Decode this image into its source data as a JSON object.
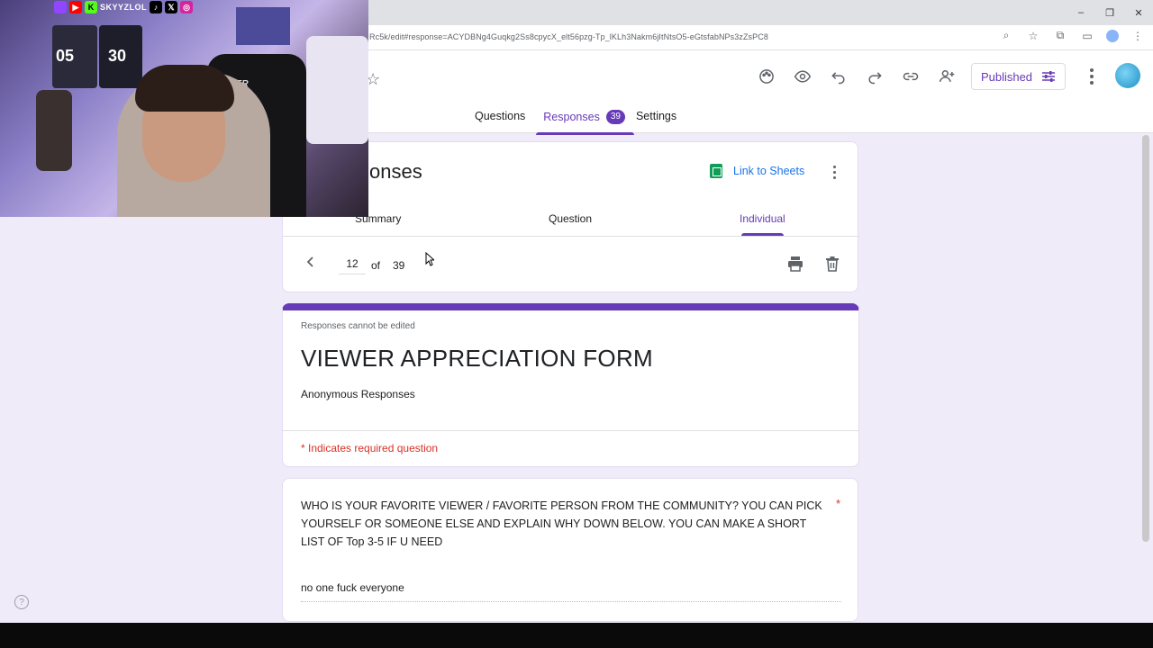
{
  "browser": {
    "url": "Rc5k/edit#response=ACYDBNg4Guqkg2Ss8cpycX_elt56pzg-Tp_lKLh3Nakm6jItNtsO5-eGtsfabNPs3zZsPC8",
    "window_controls": [
      "–",
      "❐",
      "✕"
    ]
  },
  "webcam": {
    "handle": "SKYYZLOL",
    "jersey1": "05",
    "jersey2": "30",
    "chair_brand": "RACER"
  },
  "forms_header": {
    "published_label": "Published",
    "tabs": {
      "questions": "Questions",
      "responses": "Responses",
      "responses_count": "39",
      "settings": "Settings"
    }
  },
  "responses_card": {
    "title_fragment": "onses",
    "link_to_sheets": "Link to Sheets",
    "subtabs": {
      "summary": "Summary",
      "question": "Question",
      "individual": "Individual"
    },
    "current_page": "12",
    "of_label": "of",
    "total": "39"
  },
  "form": {
    "not_editable": "Responses cannot be edited",
    "title": "VIEWER APPRECIATION FORM",
    "description": "Anonymous Responses",
    "required_note": "* Indicates required question"
  },
  "question": {
    "text": "WHO IS YOUR FAVORITE VIEWER / FAVORITE PERSON FROM THE COMMUNITY? YOU CAN PICK YOURSELF OR SOMEONE ELSE AND EXPLAIN WHY DOWN BELOW. YOU CAN MAKE A SHORT LIST OF Top 3-5 IF U NEED",
    "required_mark": "*",
    "answer": "no one fuck everyone"
  },
  "colors": {
    "accent": "#673ab7",
    "background": "#f0ebf8",
    "required": "#d93025",
    "link": "#1a73e8",
    "sheets_green": "#0f9d58"
  }
}
